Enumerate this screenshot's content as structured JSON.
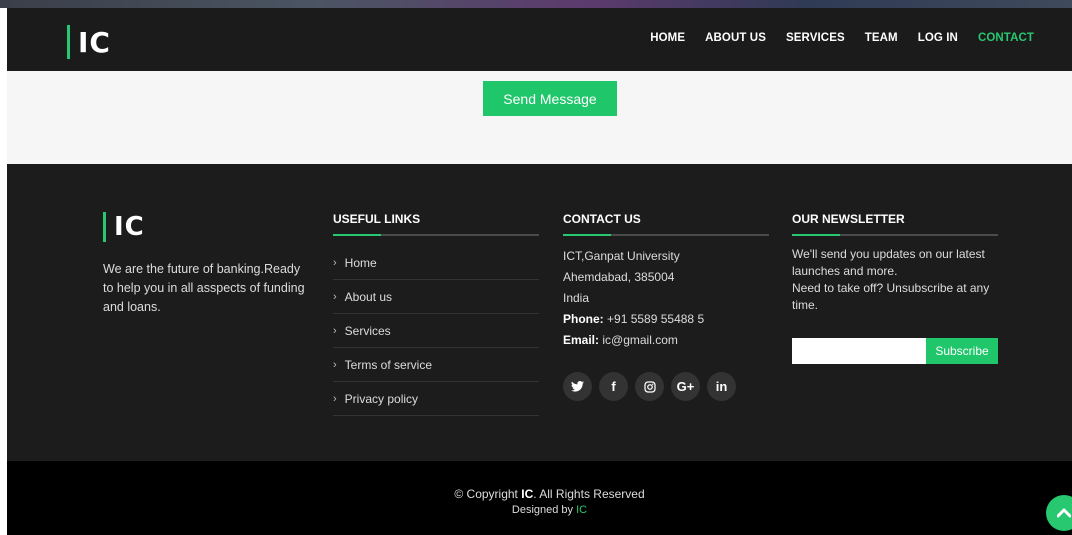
{
  "header": {
    "logo": "IC",
    "nav": [
      "HOME",
      "ABOUT US",
      "SERVICES",
      "TEAM",
      "LOG IN",
      "CONTACT"
    ],
    "active_nav": "CONTACT"
  },
  "form": {
    "send_label": "Send Message"
  },
  "footer": {
    "logo": "IC",
    "about": "We are the future of banking.Ready to help you in all asspects of funding and loans.",
    "useful_links": {
      "title": "USEFUL LINKS",
      "items": [
        "Home",
        "About us",
        "Services",
        "Terms of service",
        "Privacy policy"
      ]
    },
    "contact": {
      "title": "CONTACT US",
      "line1": "ICT,Ganpat University",
      "line2": "Ahemdabad, 385004",
      "line3": "India",
      "phone_label": "Phone:",
      "phone": "+91 5589 55488 5",
      "email_label": "Email:",
      "email": "ic@gmail.com",
      "social_icons": [
        "twitter-icon",
        "facebook-icon",
        "instagram-icon",
        "google-plus-icon",
        "linkedin-icon"
      ]
    },
    "newsletter": {
      "title": "OUR NEWSLETTER",
      "text1": "We'll send you updates on our latest launches and more.",
      "text2": "Need to take off? Unsubscribe at any time.",
      "button": "Subscribe",
      "input_value": ""
    }
  },
  "bottom": {
    "copyright_prefix": "© Copyright",
    "copyright_brand": "IC",
    "copyright_suffix": ". All Rights Reserved",
    "designed_prefix": "Designed by",
    "designed_brand": "IC"
  },
  "colors": {
    "accent": "#27c86f",
    "dark": "#1c1c1c"
  }
}
